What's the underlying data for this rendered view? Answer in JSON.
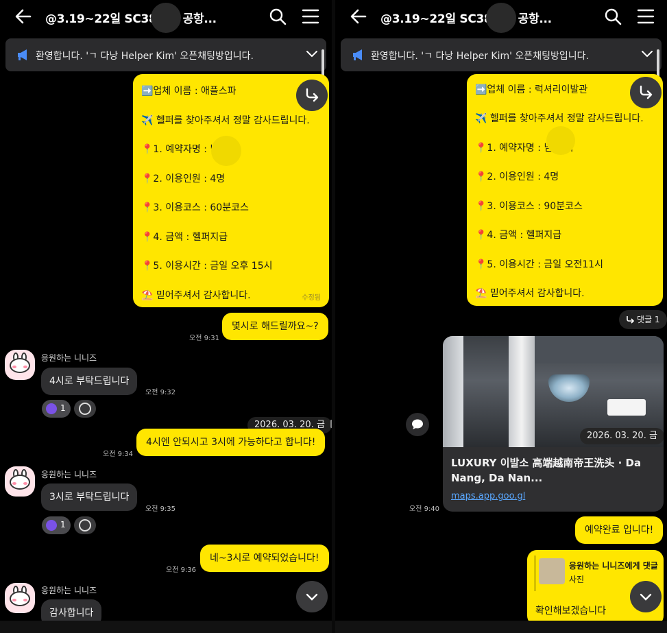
{
  "left": {
    "header": {
      "title": "@3.19~22일 SC38    4인 공항..."
    },
    "notice": {
      "text": "환영합니다. 'ㄱ 다낭 Helper Kim' 오픈채팅방입니다."
    },
    "card": {
      "lines": [
        "➡️업체 이름 : 애플스파",
        "✈️ 헬퍼를 찾아주셔서 정말 감사드립니다.",
        "📍1. 예약자명 :      님 헬퍼",
        "📍2. 이용인원 :  4명",
        "📍3. 이용코스 :  60분코스",
        "📍4. 금액 : 헬퍼지급",
        "📍5. 이용시간 : 금일 오후 15시",
        "⛱️ 믿어주셔서 감사합니다."
      ],
      "edited": "수정됨"
    },
    "messages": {
      "m1": {
        "text": "몇시로 해드릴까요~?",
        "time": "오전 9:31"
      },
      "m2": {
        "name": "응원하는 니니즈",
        "text": "4시로 부탁드립니다",
        "time": "오전 9:32",
        "reaction_count": "1"
      },
      "date": "2026. 03. 20. 금",
      "m3": {
        "text": "4시엔 안되시고 3시에 가능하다고 합니다!",
        "time": "오전 9:34"
      },
      "m4": {
        "name": "응원하는 니니즈",
        "text": "3시로 부탁드립니다",
        "time": "오전 9:35",
        "reaction_count": "1"
      },
      "m5": {
        "text": "네~3시로 예약되었습니다!",
        "time": "오전 9:36"
      },
      "m6": {
        "name": "응원하는 니니즈",
        "text": "감사합니다"
      }
    }
  },
  "right": {
    "header": {
      "title": "@3.19~22일 SC38    4인 공항..."
    },
    "notice": {
      "text": "환영합니다. 'ㄱ 다낭 Helper Kim' 오픈채팅방입니다."
    },
    "card": {
      "lines": [
        "➡️업체 이름 : 럭셔리이발관",
        "✈️ 헬퍼를 찾아주셔서 정말 감사드립니다.",
        "📍1. 예약자명 :      님 헬퍼",
        "📍2. 이용인원 :  4명",
        "📍3. 이용코스 :  90분코스",
        "📍4. 금액 : 헬퍼지급",
        "📍5. 이용시간 : 금일 오전11시",
        "⛱️ 믿어주셔서 감사합니다."
      ]
    },
    "reply_count": "댓글 1",
    "link": {
      "date": "2026. 03. 20. 금",
      "title": "LUXURY 이발소 高端越南帝王洗头 · Da Nang, Da Nan...",
      "url": "maps.app.goo.gl",
      "time": "오전 9:40"
    },
    "m1": {
      "text": "예약완료 입니다!"
    },
    "reply": {
      "name": "응원하는 니니즈에게 댓글",
      "sub": "사진",
      "text": "확인해보겠습니다"
    }
  },
  "colors": {
    "bubble_mine": "#ffe600",
    "bubble_other": "#2f2f31",
    "link": "#5aa8ff",
    "reaction": "#7a52e6"
  }
}
